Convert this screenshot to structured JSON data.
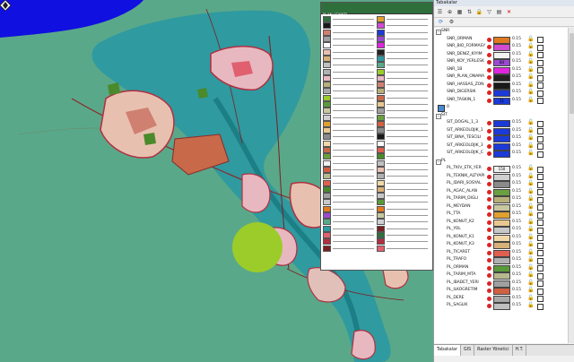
{
  "panel": {
    "title": "Tabakalar",
    "tabs": [
      "Tabakalar",
      "GIS",
      "Raster Yönetici",
      "H.T."
    ]
  },
  "colors": {
    "map_bg": "#5aa88a",
    "water": "#2f9aa0",
    "sea": "#1010e0",
    "green_area": "#9ccc2a"
  },
  "legend": {
    "title": "PLAN LEJANTI"
  },
  "layers": [
    {
      "name": "SNR",
      "group": true
    },
    {
      "name": "SNR_ORMAN",
      "color": "#e07a20",
      "num": "",
      "lw": "0.15"
    },
    {
      "name": "SNR_BIO_FORMASY",
      "color": "#d04bd0",
      "num": "",
      "lw": "0.15"
    },
    {
      "name": "SNR_DENIZ_KIYIM",
      "color": "#f2f2f2",
      "num": "",
      "lw": "0.15"
    },
    {
      "name": "SNR_KOY_YERLESK",
      "color": "#9a4ad0",
      "num": "84",
      "lw": "0.15"
    },
    {
      "name": "SNR_1B",
      "color": "#e026e0",
      "num": "",
      "lw": "0.15"
    },
    {
      "name": "SNR_PLAN_ONAMA",
      "color": "#222222",
      "num": "",
      "lw": "0.15"
    },
    {
      "name": "SNR_HASSAS_ZON",
      "color": "#1a1a1a",
      "num": "",
      "lw": "0.15"
    },
    {
      "name": "SNR_DIGERSIK",
      "color": "#1c3ad8",
      "num": "",
      "lw": "0.15"
    },
    {
      "name": "SNR_TASKIN_1",
      "color": "#1c3ad8",
      "num": "11",
      "lw": "0.15"
    },
    {
      "name": "0",
      "color": "",
      "num": "",
      "lw": "",
      "special": true
    },
    {
      "name": "SIT",
      "group": true
    },
    {
      "name": "SIT_DOGAL_1_3",
      "color": "#1c3ad8",
      "num": "",
      "lw": "0.15"
    },
    {
      "name": "SIT_ARKEOLOJIK_1",
      "color": "#1c3ad8",
      "num": "",
      "lw": "0.15"
    },
    {
      "name": "SIT_BINA_TESCILI",
      "color": "#1c3ad8",
      "num": "",
      "lw": "0.15"
    },
    {
      "name": "SIT_ARKEOLOJIK_3",
      "color": "#1c3ad8",
      "num": "",
      "lw": "0.15"
    },
    {
      "name": "SIT_ARKEOLOJIK_C",
      "color": "#1c3ad8",
      "num": "",
      "lw": "0.15"
    },
    {
      "name": "PL",
      "group": true
    },
    {
      "name": "PL_TKIV_ETK_YER",
      "color": "#f0f0f0",
      "num": "150",
      "lw": "0.15"
    },
    {
      "name": "PL_TEKNIK_ALTYAPI",
      "color": "#d0d0d0",
      "num": "",
      "lw": "0.15"
    },
    {
      "name": "PL_IDARI_SOSYAL",
      "color": "#8a8a8a",
      "num": "",
      "lw": "0.15"
    },
    {
      "name": "PL_AGAC_ALAN",
      "color": "#6aa040",
      "num": "",
      "lw": "0.15"
    },
    {
      "name": "PL_TARIM_DIGLI",
      "color": "#b7b07a",
      "num": "",
      "lw": "0.15"
    },
    {
      "name": "PL_MEYDAN",
      "color": "#c8c8a0",
      "num": "",
      "lw": "0.15"
    },
    {
      "name": "PL_TTA",
      "color": "#e0a030",
      "num": "",
      "lw": "0.15"
    },
    {
      "name": "PL_KONUT_K2",
      "color": "#e8c890",
      "num": "",
      "lw": "0.15"
    },
    {
      "name": "PL_YOL",
      "color": "#c8c8c8",
      "num": "",
      "lw": "0.15"
    },
    {
      "name": "PL_KONUT_K1",
      "color": "#f0d8a8",
      "num": "",
      "lw": "0.15"
    },
    {
      "name": "PL_KONUT_K3",
      "color": "#d8b078",
      "num": "",
      "lw": "0.15"
    },
    {
      "name": "PL_TICARET",
      "color": "#e06050",
      "num": "",
      "lw": "0.15"
    },
    {
      "name": "PL_TRAFO",
      "color": "#b0b0b0",
      "num": "",
      "lw": "0.15"
    },
    {
      "name": "PL_ORMAN",
      "color": "#5a9a3a",
      "num": "",
      "lw": "0.15"
    },
    {
      "name": "PL_TARIM_MTA",
      "color": "#b8b890",
      "num": "",
      "lw": "0.15"
    },
    {
      "name": "PL_IBADET_YERI",
      "color": "#a0a0a0",
      "num": "",
      "lw": "0.15"
    },
    {
      "name": "PL_ILKOGRETIM",
      "color": "#d06040",
      "num": "",
      "lw": "0.15"
    },
    {
      "name": "PL_DERE",
      "color": "#a8a8a8",
      "num": "",
      "lw": "0.15"
    },
    {
      "name": "PL_SAGLIK",
      "color": "#c0c0c0",
      "num": "",
      "lw": "0.15"
    }
  ]
}
